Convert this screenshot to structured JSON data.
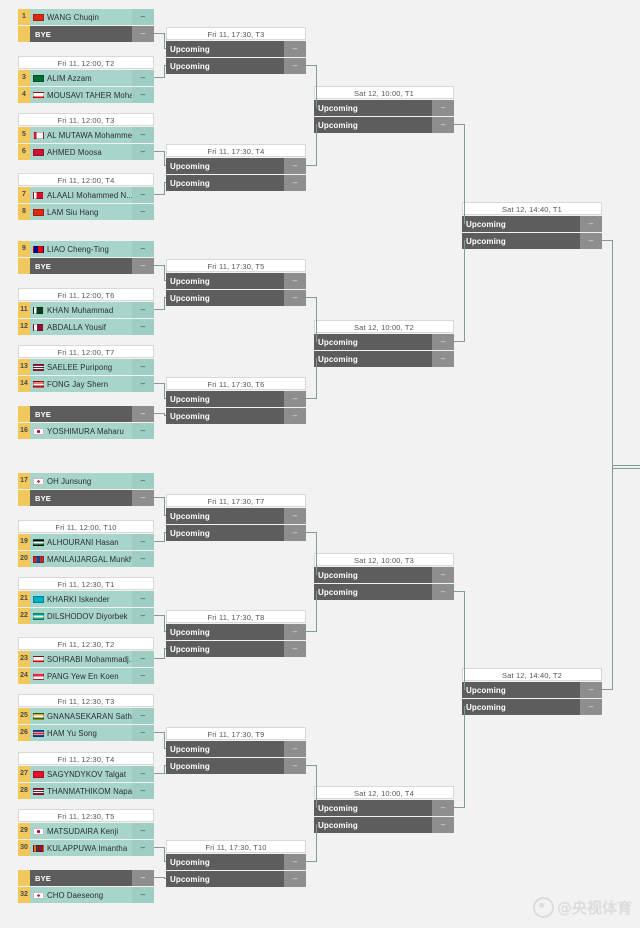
{
  "meta": {
    "watermark": "@央视体育",
    "score_placeholder": "–",
    "bye_label": "BYE",
    "upcoming_label": "Upcoming"
  },
  "colors": {
    "page_bg": "#f2f2f2",
    "player_row": "#a8d5cb",
    "score_cell": "#9ecec3",
    "seed_cell": "#f2c75c",
    "grey_row": "#5d5d5d",
    "grey_score": "#8e8e8e",
    "header_bg": "#ffffff",
    "connector": "#7d9d95"
  },
  "rounds": {
    "r32": [
      {
        "header": "",
        "show_header": false,
        "players": [
          {
            "seed": "1",
            "name": "WANG Chuqin",
            "flag": "cn",
            "score": "–",
            "bye": false
          },
          {
            "seed": "",
            "name": "BYE",
            "flag": "",
            "score": "–",
            "bye": true
          }
        ]
      },
      {
        "header": "Fri 11, 12:00, T2",
        "show_header": true,
        "players": [
          {
            "seed": "3",
            "name": "ALIM Azzam",
            "flag": "sa",
            "score": "–",
            "bye": false
          },
          {
            "seed": "4",
            "name": "MOUSAVI TAHER Moha...",
            "flag": "ir",
            "score": "–",
            "bye": false
          }
        ]
      },
      {
        "header": "Fri 11, 12:00, T3",
        "show_header": true,
        "players": [
          {
            "seed": "5",
            "name": "AL MUTAWA Mohammed",
            "flag": "om",
            "score": "–",
            "bye": false
          },
          {
            "seed": "6",
            "name": "AHMED Moosa",
            "flag": "mv",
            "score": "–",
            "bye": false
          }
        ]
      },
      {
        "header": "Fri 11, 12:00, T4",
        "show_header": true,
        "players": [
          {
            "seed": "7",
            "name": "ALAALI Mohammed N...",
            "flag": "bh",
            "score": "–",
            "bye": false
          },
          {
            "seed": "8",
            "name": "LAM Siu Hang",
            "flag": "hk",
            "score": "–",
            "bye": false
          }
        ]
      },
      {
        "header": "",
        "show_header": false,
        "players": [
          {
            "seed": "9",
            "name": "LIAO Cheng-Ting",
            "flag": "tw",
            "score": "–",
            "bye": false
          },
          {
            "seed": "",
            "name": "BYE",
            "flag": "",
            "score": "–",
            "bye": true
          }
        ]
      },
      {
        "header": "Fri 11, 12:00, T6",
        "show_header": true,
        "players": [
          {
            "seed": "11",
            "name": "KHAN Muhammad",
            "flag": "pk",
            "score": "–",
            "bye": false
          },
          {
            "seed": "12",
            "name": "ABDALLA Yousif",
            "flag": "qa",
            "score": "–",
            "bye": false
          }
        ]
      },
      {
        "header": "Fri 11, 12:00, T7",
        "show_header": true,
        "players": [
          {
            "seed": "13",
            "name": "SAELEE Puripong",
            "flag": "th",
            "score": "–",
            "bye": false
          },
          {
            "seed": "14",
            "name": "FONG Jay Shern",
            "flag": "my",
            "score": "–",
            "bye": false
          }
        ]
      },
      {
        "header": "",
        "show_header": false,
        "players": [
          {
            "seed": "",
            "name": "BYE",
            "flag": "",
            "score": "–",
            "bye": true
          },
          {
            "seed": "16",
            "name": "YOSHIMURA Maharu",
            "flag": "jp",
            "score": "–",
            "bye": false
          }
        ]
      },
      {
        "header": "",
        "show_header": false,
        "players": [
          {
            "seed": "17",
            "name": "OH Junsung",
            "flag": "kr",
            "score": "–",
            "bye": false
          },
          {
            "seed": "",
            "name": "BYE",
            "flag": "",
            "score": "–",
            "bye": true
          }
        ]
      },
      {
        "header": "Fri 11, 12:00, T10",
        "show_header": true,
        "players": [
          {
            "seed": "19",
            "name": "ALHOURANI Hasan",
            "flag": "jo",
            "score": "–",
            "bye": false
          },
          {
            "seed": "20",
            "name": "MANLAIJARGAL Munkh...",
            "flag": "mn",
            "score": "–",
            "bye": false
          }
        ]
      },
      {
        "header": "Fri 11, 12:30, T1",
        "show_header": true,
        "players": [
          {
            "seed": "21",
            "name": "KHARKI Iskender",
            "flag": "kz",
            "score": "–",
            "bye": false
          },
          {
            "seed": "22",
            "name": "DILSHODOV Diyorbek",
            "flag": "uz",
            "score": "–",
            "bye": false
          }
        ]
      },
      {
        "header": "Fri 11, 12:30, T2",
        "show_header": true,
        "players": [
          {
            "seed": "23",
            "name": "SOHRABI Mohammadj...",
            "flag": "ir",
            "score": "–",
            "bye": false
          },
          {
            "seed": "24",
            "name": "PANG Yew En Koen",
            "flag": "sg",
            "score": "–",
            "bye": false
          }
        ]
      },
      {
        "header": "Fri 11, 12:30, T3",
        "show_header": true,
        "players": [
          {
            "seed": "25",
            "name": "GNANASEKARAN Sathiy...",
            "flag": "in",
            "score": "–",
            "bye": false
          },
          {
            "seed": "26",
            "name": "HAM Yu Song",
            "flag": "kp",
            "score": "–",
            "bye": false
          }
        ]
      },
      {
        "header": "Fri 11, 12:30, T4",
        "show_header": true,
        "players": [
          {
            "seed": "27",
            "name": "SAGYNDYKOV Talgat",
            "flag": "kg",
            "score": "–",
            "bye": false
          },
          {
            "seed": "28",
            "name": "THANMATHIKOM Napat",
            "flag": "th",
            "score": "–",
            "bye": false
          }
        ]
      },
      {
        "header": "Fri 11, 12:30, T5",
        "show_header": true,
        "players": [
          {
            "seed": "29",
            "name": "MATSUDAIRA Kenji",
            "flag": "jp",
            "score": "–",
            "bye": false
          },
          {
            "seed": "30",
            "name": "KULAPPUWA Imantha",
            "flag": "lk",
            "score": "–",
            "bye": false
          }
        ]
      },
      {
        "header": "",
        "show_header": false,
        "players": [
          {
            "seed": "",
            "name": "BYE",
            "flag": "",
            "score": "–",
            "bye": true
          },
          {
            "seed": "32",
            "name": "CHO Daeseong",
            "flag": "kr",
            "score": "–",
            "bye": false
          }
        ]
      }
    ],
    "r16": [
      {
        "header": "Fri 11, 17:30, T3",
        "players": [
          {
            "name": "Upcoming",
            "score": "–"
          },
          {
            "name": "Upcoming",
            "score": "–"
          }
        ]
      },
      {
        "header": "Fri 11, 17:30, T4",
        "players": [
          {
            "name": "Upcoming",
            "score": "–"
          },
          {
            "name": "Upcoming",
            "score": "–"
          }
        ]
      },
      {
        "header": "Fri 11, 17:30, T5",
        "players": [
          {
            "name": "Upcoming",
            "score": "–"
          },
          {
            "name": "Upcoming",
            "score": "–"
          }
        ]
      },
      {
        "header": "Fri 11, 17:30, T6",
        "players": [
          {
            "name": "Upcoming",
            "score": "–"
          },
          {
            "name": "Upcoming",
            "score": "–"
          }
        ]
      },
      {
        "header": "Fri 11, 17:30, T7",
        "players": [
          {
            "name": "Upcoming",
            "score": "–"
          },
          {
            "name": "Upcoming",
            "score": "–"
          }
        ]
      },
      {
        "header": "Fri 11, 17:30, T8",
        "players": [
          {
            "name": "Upcoming",
            "score": "–"
          },
          {
            "name": "Upcoming",
            "score": "–"
          }
        ]
      },
      {
        "header": "Fri 11, 17:30, T9",
        "players": [
          {
            "name": "Upcoming",
            "score": "–"
          },
          {
            "name": "Upcoming",
            "score": "–"
          }
        ]
      },
      {
        "header": "Fri 11, 17:30, T10",
        "players": [
          {
            "name": "Upcoming",
            "score": "–"
          },
          {
            "name": "Upcoming",
            "score": "–"
          }
        ]
      }
    ],
    "qf": [
      {
        "header": "Sat 12, 10:00, T1",
        "players": [
          {
            "name": "Upcoming",
            "score": "–"
          },
          {
            "name": "Upcoming",
            "score": "–"
          }
        ]
      },
      {
        "header": "Sat 12, 10:00, T2",
        "players": [
          {
            "name": "Upcoming",
            "score": "–"
          },
          {
            "name": "Upcoming",
            "score": "–"
          }
        ]
      },
      {
        "header": "Sat 12, 10:00, T3",
        "players": [
          {
            "name": "Upcoming",
            "score": "–"
          },
          {
            "name": "Upcoming",
            "score": "–"
          }
        ]
      },
      {
        "header": "Sat 12, 10:00, T4",
        "players": [
          {
            "name": "Upcoming",
            "score": "–"
          },
          {
            "name": "Upcoming",
            "score": "–"
          }
        ]
      }
    ],
    "sf": [
      {
        "header": "Sat 12, 14:40, T1",
        "players": [
          {
            "name": "Upcoming",
            "score": "–"
          },
          {
            "name": "Upcoming",
            "score": "–"
          }
        ]
      },
      {
        "header": "Sat 12, 14:40, T2",
        "players": [
          {
            "name": "Upcoming",
            "score": "–"
          },
          {
            "name": "Upcoming",
            "score": "–"
          }
        ]
      }
    ]
  }
}
